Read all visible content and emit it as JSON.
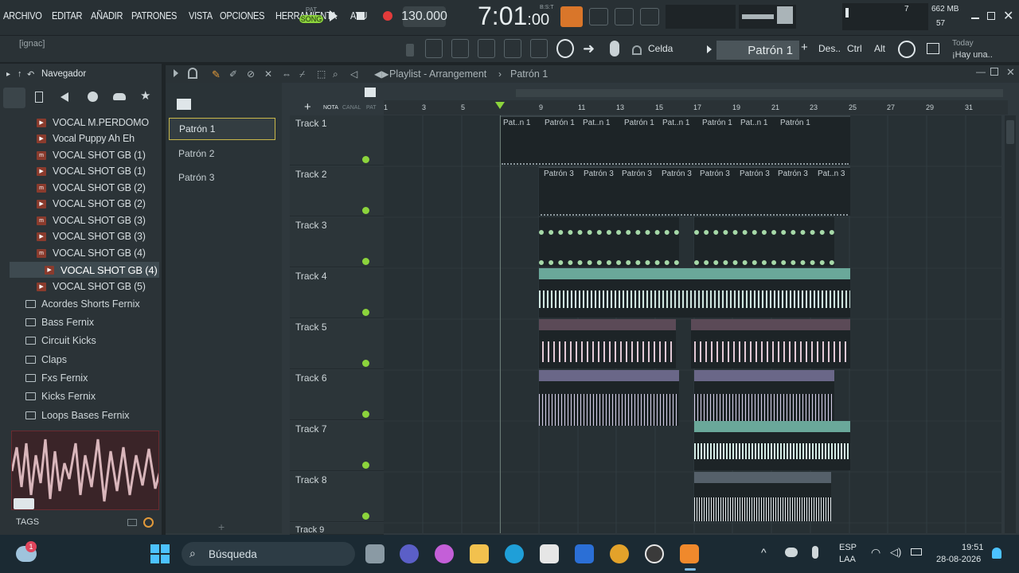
{
  "menu": [
    "ARCHIVO",
    "EDITAR",
    "AÑADIR",
    "PATRONES",
    "VISTA",
    "OPCIONES",
    "HERRAMIENTA",
    "AYU"
  ],
  "transport": {
    "pat_label": "PAT",
    "song_label": "SONG",
    "tempo": "130.000",
    "time": "7:01",
    "time_sub": ":00",
    "bst": "B:S:T"
  },
  "cpu": {
    "ram": "662 MB",
    "voices": "7",
    "voices2": "57"
  },
  "hint": {
    "user": "[ignac]",
    "snap": "Celda",
    "pattern": "Patrón 1",
    "des": "Des..",
    "ctrl": "Ctrl",
    "alt": "Alt",
    "today": "Today",
    "today_sub": "¡Hay una.."
  },
  "browser": {
    "title": "Navegador",
    "files": [
      "VOCAL M.PERDOMO",
      "Vocal Puppy Ah Eh",
      "VOCAL SHOT GB (1)",
      "VOCAL SHOT GB (1)",
      "VOCAL SHOT GB (2)",
      "VOCAL SHOT GB (2)",
      "VOCAL SHOT GB (3)",
      "VOCAL SHOT GB (3)",
      "VOCAL SHOT GB (4)",
      "VOCAL SHOT GB (4)",
      "VOCAL SHOT GB (5)"
    ],
    "folders": [
      "Acordes Shorts Fernix",
      "Bass Fernix",
      "Circuit Kicks",
      "Claps",
      "Fxs Fernix",
      "Kicks Fernix",
      "Loops Bases Fernix"
    ],
    "tags": "TAGS"
  },
  "playlist": {
    "title": "Playlist - Arrangement",
    "crumb": "Patrón 1",
    "col_labels": [
      "NOTA",
      "CANAL",
      "PAT"
    ],
    "patterns": [
      "Patrón 1",
      "Patrón 2",
      "Patrón 3"
    ],
    "ruler": [
      "1",
      "3",
      "5",
      "9",
      "11",
      "13",
      "15",
      "17",
      "19",
      "21",
      "23",
      "25",
      "27",
      "29",
      "31"
    ],
    "tracks": [
      "Track 1",
      "Track 2",
      "Track 3",
      "Track 4",
      "Track 5",
      "Track 6",
      "Track 7",
      "Track 8",
      "Track 9"
    ],
    "clip_labels_1": [
      "Pat..n 1",
      "Patrón 1",
      "Pat..n 1",
      "Patrón 1",
      "Pat..n 1",
      "Patrón 1",
      "Pat..n 1",
      "Patrón 1"
    ],
    "clip_labels_2": [
      "Patrón 3",
      "Patrón 3",
      "Patrón 3",
      "Patrón 3",
      "Patrón 3",
      "Patrón 3",
      "Patrón 3",
      "Pat..n 3"
    ],
    "accent": "#8cd43c"
  },
  "taskbar": {
    "search": "Búsqueda",
    "lang": "ESP",
    "lang2": "LAA",
    "clock": "19:51",
    "date": "28-08-2026",
    "badge": "1"
  }
}
